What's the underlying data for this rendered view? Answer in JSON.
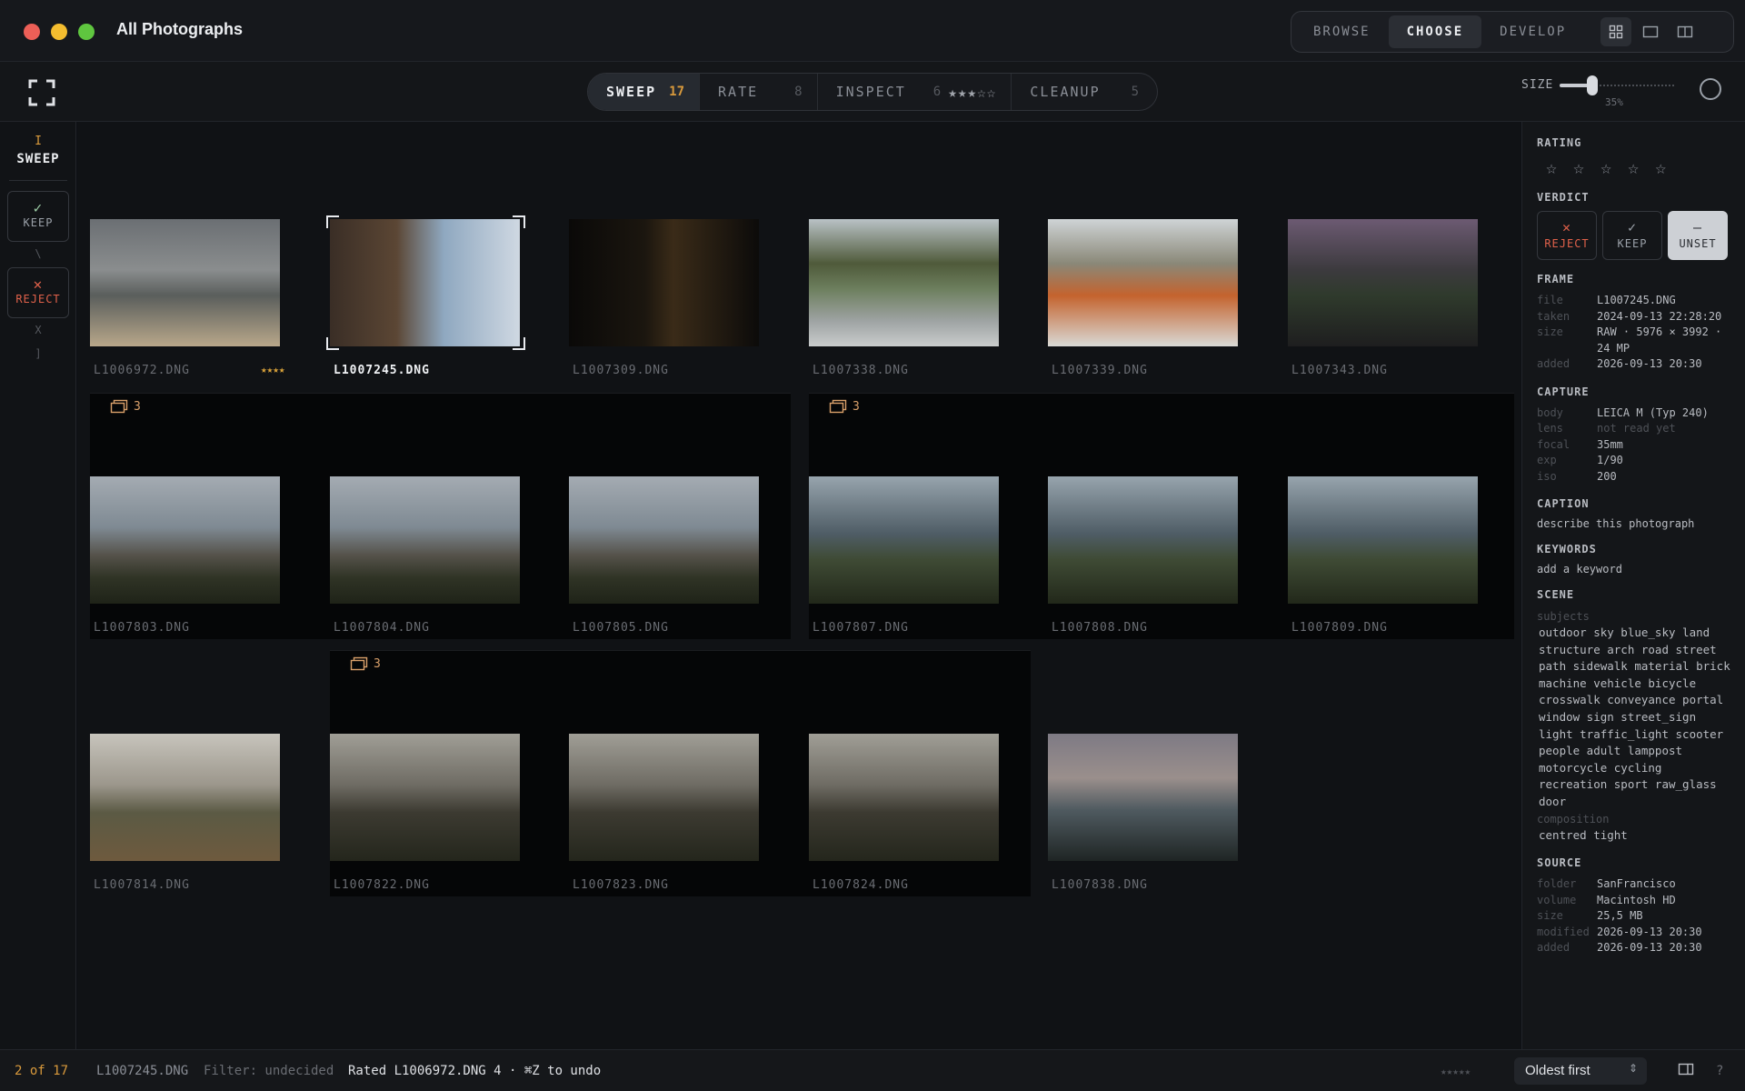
{
  "window": {
    "title": "All Photographs"
  },
  "modes": [
    {
      "label": "BROWSE",
      "active": false
    },
    {
      "label": "CHOOSE",
      "active": true
    },
    {
      "label": "DEVELOP",
      "active": false
    }
  ],
  "view_icons": [
    "grid-view-icon",
    "single-view-icon",
    "split-view-icon"
  ],
  "passes": [
    {
      "label": "SWEEP",
      "count": "17",
      "active": true
    },
    {
      "label": "RATE",
      "count": "8",
      "active": false
    },
    {
      "label": "INSPECT",
      "count": "6",
      "stars": "★★★☆☆",
      "active": false
    },
    {
      "label": "CLEANUP",
      "count": "5",
      "active": false
    }
  ],
  "size": {
    "label": "SIZE",
    "value": "35%",
    "fraction": 0.35
  },
  "leftbar": {
    "pass_key": "I",
    "pass_label": "SWEEP",
    "keep_label": "KEEP",
    "keep_key": "\\",
    "reject_label": "REJECT",
    "reject_key": "X",
    "bracket_key": "]"
  },
  "photos": [
    {
      "file": "L1006972.DNG",
      "stars": "★★★★",
      "tone": "beach"
    },
    {
      "file": "L1007245.DNG",
      "selected": true,
      "tone": "street"
    },
    {
      "file": "L1007309.DNG",
      "tone": "dark"
    },
    {
      "file": "L1007338.DNG",
      "tone": "tram"
    },
    {
      "file": "L1007339.DNG",
      "tone": "tram-orange"
    },
    {
      "file": "L1007343.DNG",
      "tone": "tram-dusk"
    },
    {
      "file": "L1007803.DNG",
      "tone": "bridge"
    },
    {
      "file": "L1007804.DNG",
      "tone": "bridge"
    },
    {
      "file": "L1007805.DNG",
      "tone": "bridge"
    },
    {
      "file": "L1007807.DNG",
      "tone": "cypress"
    },
    {
      "file": "L1007808.DNG",
      "tone": "cypress"
    },
    {
      "file": "L1007809.DNG",
      "tone": "cypress"
    },
    {
      "file": "L1007814.DNG",
      "tone": "bridge-hill"
    },
    {
      "file": "L1007822.DNG",
      "tone": "bridge-dark"
    },
    {
      "file": "L1007823.DNG",
      "tone": "bridge-dark"
    },
    {
      "file": "L1007824.DNG",
      "tone": "bridge-dark"
    },
    {
      "file": "L1007838.DNG",
      "tone": "bay"
    }
  ],
  "stacks": [
    {
      "count": "3"
    },
    {
      "count": "3"
    },
    {
      "count": "3"
    }
  ],
  "inspector": {
    "rating_label": "RATING",
    "verdict_label": "VERDICT",
    "verdict": [
      {
        "glyph": "✕",
        "label": "REJECT",
        "active": false,
        "color": "#e0614a"
      },
      {
        "glyph": "✓",
        "label": "KEEP",
        "active": false,
        "color": "#9aa0a8"
      },
      {
        "glyph": "–",
        "label": "UNSET",
        "active": true,
        "color": "#2a2d32"
      }
    ],
    "frame_label": "FRAME",
    "frame": [
      {
        "k": "file",
        "v": "L1007245.DNG"
      },
      {
        "k": "taken",
        "v": "2024-09-13 22:28:20"
      },
      {
        "k": "size",
        "v": "RAW · 5976 × 3992 · 24 MP"
      },
      {
        "k": "added",
        "v": "2026-09-13 20:30"
      }
    ],
    "capture_label": "CAPTURE",
    "capture": [
      {
        "k": "body",
        "v": "LEICA M (Typ 240)"
      },
      {
        "k": "lens",
        "v": "not read yet",
        "dim": true
      },
      {
        "k": "focal",
        "v": "35mm"
      },
      {
        "k": "exp",
        "v": "1/90"
      },
      {
        "k": "iso",
        "v": "200"
      }
    ],
    "caption_label": "CAPTION",
    "caption_placeholder": "describe this photograph",
    "keywords_label": "KEYWORDS",
    "keywords_placeholder": "add a keyword",
    "scene_label": "SCENE",
    "subjects_label": "subjects",
    "subjects": "outdoor sky blue_sky land structure arch road street path sidewalk material brick machine vehicle bicycle crosswalk conveyance portal window sign street_sign light traffic_light scooter people adult lamppost motorcycle cycling recreation sport raw_glass door",
    "composition_label": "composition",
    "composition": "centred tight",
    "source_label": "SOURCE",
    "source": [
      {
        "k": "folder",
        "v": "SanFrancisco"
      },
      {
        "k": "volume",
        "v": "Macintosh HD"
      },
      {
        "k": "size",
        "v": "25,5 MB"
      },
      {
        "k": "modified",
        "v": "2026-09-13 20:30"
      },
      {
        "k": "added",
        "v": "2026-09-13 20:30"
      }
    ]
  },
  "status": {
    "position": "2 of 17",
    "file": "L1007245.DNG",
    "filter": "Filter: undecided",
    "message": "Rated L1006972.DNG 4 · ⌘Z to undo",
    "stars": "★★★★★",
    "sort": "Oldest first",
    "help": "?"
  },
  "colors": {
    "accent": "#d99a3c",
    "reject": "#e0614a",
    "keep": "#7fb88a"
  }
}
